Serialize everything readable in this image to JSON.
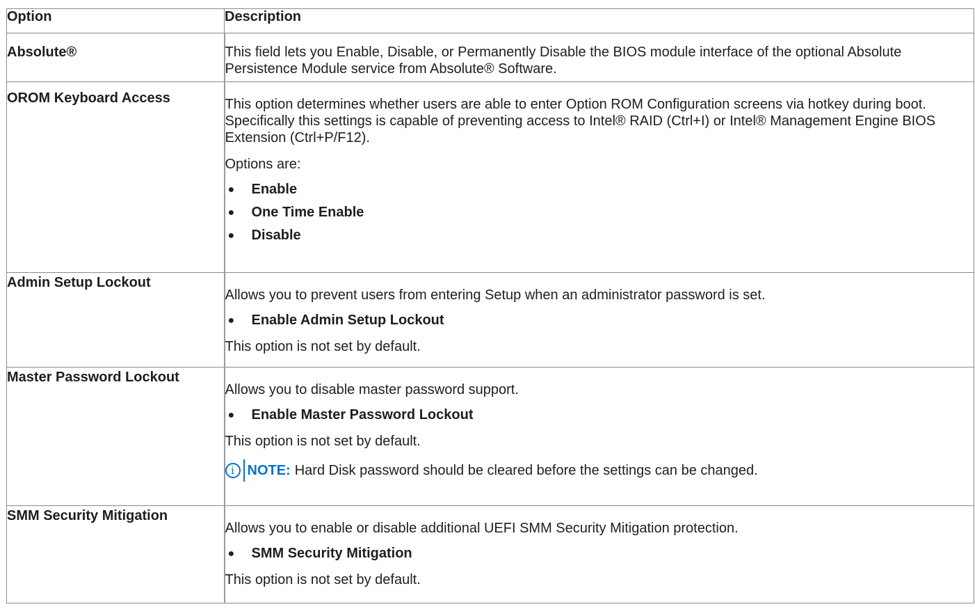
{
  "table": {
    "headers": [
      "Option",
      "Description"
    ],
    "rows": [
      {
        "option": "Absolute®",
        "desc": "This field lets you Enable, Disable, or Permanently Disable the BIOS module interface of the optional Absolute Persistence Module service from Absolute® Software."
      },
      {
        "option": "OROM Keyboard Access",
        "desc": "This option determines whether users are able to enter Option ROM Configuration screens via hotkey during boot. Specifically this settings is capable of preventing access to Intel® RAID (Ctrl+I) or Intel® Management Engine BIOS Extension (Ctrl+P/F12).",
        "options_label": "Options are:",
        "options": [
          "Enable",
          "One Time Enable",
          "Disable"
        ]
      },
      {
        "option": "Admin Setup Lockout",
        "desc": "Allows you to prevent users from entering Setup when an administrator password is set.",
        "bullet": "Enable Admin Setup Lockout",
        "default_note": "This option is not set by default."
      },
      {
        "option": "Master Password Lockout",
        "desc": "Allows you to disable master password support.",
        "bullet": "Enable Master Password Lockout",
        "default_note": "This option is not set by default.",
        "note_label": "NOTE:",
        "note_text": "Hard Disk password should be cleared before the settings can be changed."
      },
      {
        "option": "SMM Security Mitigation",
        "desc": "Allows you to enable or disable additional UEFI SMM Security Mitigation protection.",
        "bullet": "SMM Security Mitigation",
        "default_note": "This option is not set by default."
      }
    ]
  },
  "icons": {
    "bullet": "●",
    "info": "i"
  },
  "colors": {
    "note_accent": "#0672cb",
    "border": "#8a8a8a"
  }
}
